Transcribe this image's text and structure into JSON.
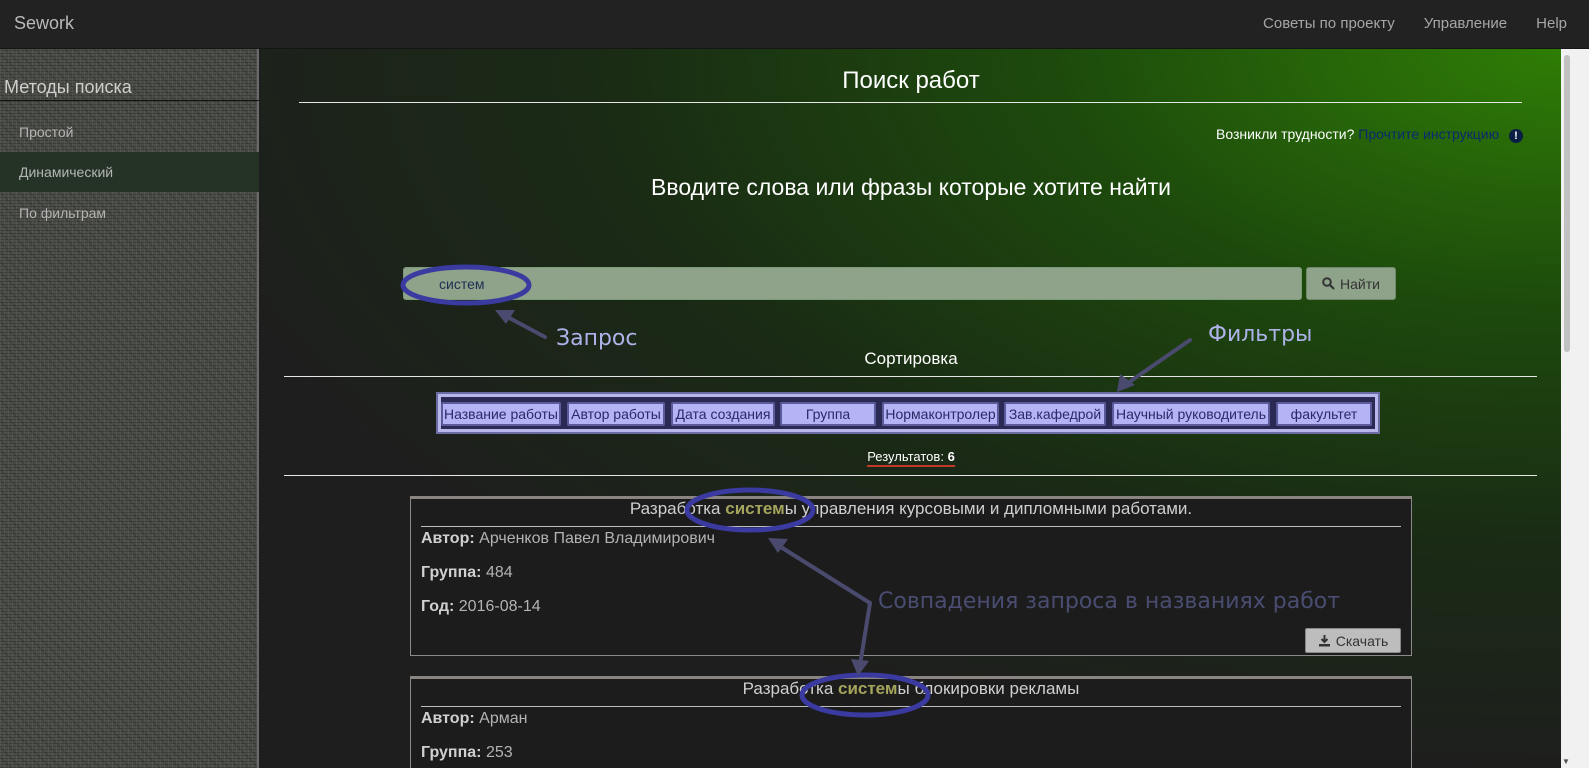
{
  "navbar": {
    "brand": "Sework",
    "links": [
      "Советы по проекту",
      "Управление",
      "Help"
    ]
  },
  "sidebar": {
    "title": "Методы поиска",
    "items": [
      {
        "label": "Простой",
        "active": false
      },
      {
        "label": "Динамический",
        "active": true
      },
      {
        "label": "По фильтрам",
        "active": false
      }
    ]
  },
  "main": {
    "title": "Поиск работ",
    "help_question": "Возникли трудности?",
    "help_link": "Прочтите инструкцию",
    "lead": "Вводите слова или фразы которые хотите найти",
    "search": {
      "value": "систем",
      "button_label": "Найти"
    },
    "sort_label": "Сортировка",
    "sort_buttons": [
      "Название работы",
      "Автор работы",
      "Дата создания",
      "Группа",
      "Нормаконтролер",
      "Зав.кафедрой",
      "Научный руководитель",
      "факультет"
    ],
    "results_label": "Результатов:",
    "results_count": "6",
    "labels": {
      "author": "Автор:",
      "group": "Группа:",
      "year": "Год:"
    },
    "download_label": "Скачать",
    "cards": [
      {
        "title_before": "Разработка ",
        "title_highlight": "систем",
        "title_after": "ы управления курсовыми и дипломными работами.",
        "author": "Арченков Павел Владимирович",
        "group": "484",
        "year": "2016-08-14"
      },
      {
        "title_before": "Разработка ",
        "title_highlight": "систем",
        "title_after": "ы блокировки рекламы",
        "author": "Арман",
        "group": "253"
      }
    ]
  },
  "annotations": {
    "query": "Запрос",
    "filters": "Фильтры",
    "matches": "Совпадения запроса в названиях работ"
  },
  "colors": {
    "accent_green": "#2f7d06",
    "highlight": "#a4a45c",
    "annotation_ring": "#3a3aa0",
    "sort_button": "#b3b3f5"
  }
}
